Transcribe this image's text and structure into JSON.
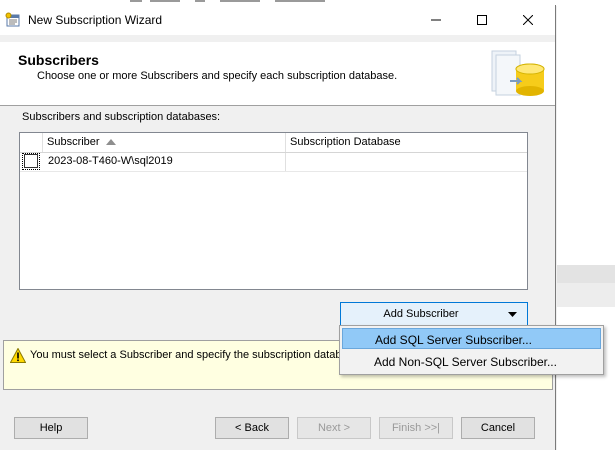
{
  "window": {
    "title": "New Subscription Wizard"
  },
  "header": {
    "title": "Subscribers",
    "subtitle": "Choose one or more Subscribers and specify each subscription database."
  },
  "grid": {
    "caption": "Subscribers and subscription databases:",
    "columns": [
      "Subscriber",
      "Subscription Database"
    ],
    "sorted_column": "Subscriber",
    "rows": [
      {
        "checked": false,
        "subscriber": "2023-08-T460-W\\sql2019",
        "database": ""
      }
    ]
  },
  "add_subscriber_button": {
    "label": "Add Subscriber"
  },
  "dropdown_menu": {
    "items": [
      "Add SQL Server Subscriber...",
      "Add Non-SQL Server Subscriber..."
    ],
    "highlighted_index": 0
  },
  "message": {
    "text": "You must select a Subscriber and specify the subscription databas"
  },
  "buttons": {
    "help": "Help",
    "back": "< Back",
    "next": "Next >",
    "finish": "Finish >>|",
    "cancel": "Cancel"
  }
}
